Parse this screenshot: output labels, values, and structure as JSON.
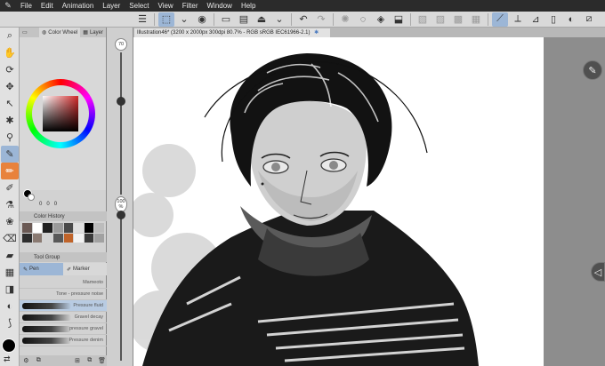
{
  "menu": {
    "items": [
      "File",
      "Edit",
      "Animation",
      "Layer",
      "Select",
      "View",
      "Filter",
      "Window",
      "Help"
    ]
  },
  "panel": {
    "tabs": [
      "Color Wheel",
      "Layer"
    ],
    "color_values": [
      "0",
      "0",
      "0"
    ],
    "history_title": "Color History",
    "history_colors": [
      "#6b5a55",
      "#ffffff",
      "#202020",
      "#9a9a9a",
      "#4a4a4a",
      "#e0e0e0",
      "#000000",
      "#bcbcbc",
      "#2e2e2e",
      "#8a7a72",
      "#d3d3d3",
      "#585858",
      "#c0642a",
      "#f2f2f2",
      "#3a3a3a",
      "#a1a1a1"
    ],
    "tool_group_title": "Tool Group",
    "subtools": [
      "Pen",
      "Marker"
    ],
    "brushes": [
      "Mameoto",
      "Tone - pressure noise",
      "Pressure fluid",
      "Gravel decay",
      "pressure gravel",
      "Pressure denim"
    ]
  },
  "slider": {
    "size_value": "70",
    "opacity_value": "100",
    "opacity_unit": "%"
  },
  "document": {
    "tab_title": "Illustration46* (3200 x 2000px 300dpi 80.7% - RGB sRGB IEC61966-2.1)"
  },
  "colors": {
    "accent_blue": "#9cb6d6",
    "accent_orange": "#e8823c",
    "menubar": "#2b2b2b"
  },
  "icons": {
    "toolbar": [
      "menu-icon",
      "selection-icon",
      "chevron-down-icon",
      "animation-icon",
      "new-icon",
      "open-icon",
      "save-icon",
      "undo-icon",
      "redo-icon",
      "loading-icon",
      "fill-icon",
      "transform-icon"
    ],
    "left_tools": [
      "zoom-icon",
      "hand-icon",
      "rotate-icon",
      "move-icon",
      "select-icon",
      "wand-icon",
      "eyedropper-icon",
      "pen-icon",
      "pencil-icon",
      "brush-icon",
      "airbrush-icon",
      "decoration-icon",
      "eraser-icon",
      "fill-bucket-icon",
      "gradient-icon",
      "shape-icon",
      "text-icon",
      "balloon-icon"
    ]
  }
}
